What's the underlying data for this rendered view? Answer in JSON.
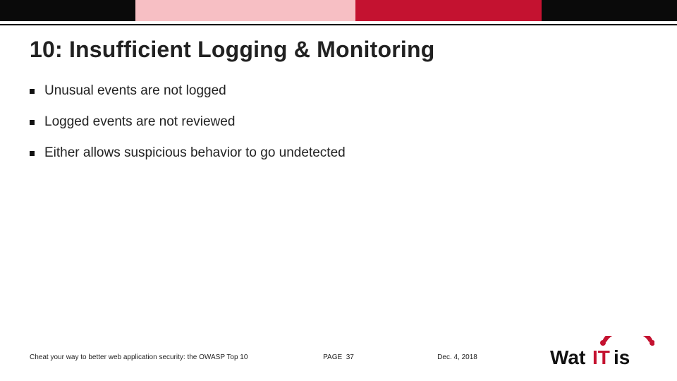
{
  "title": "10: Insufficient Logging & Monitoring",
  "bullets": [
    "Unusual events are not logged",
    "Logged events are not reviewed",
    "Either allows suspicious behavior to go undetected"
  ],
  "footer": {
    "title": "Cheat your way to better web application security: the OWASP Top 10",
    "page_label": "PAGE",
    "page_number": "37",
    "date": "Dec. 4, 2018"
  },
  "logo": {
    "wat": "Wat",
    "it": "IT",
    "is": "is"
  }
}
